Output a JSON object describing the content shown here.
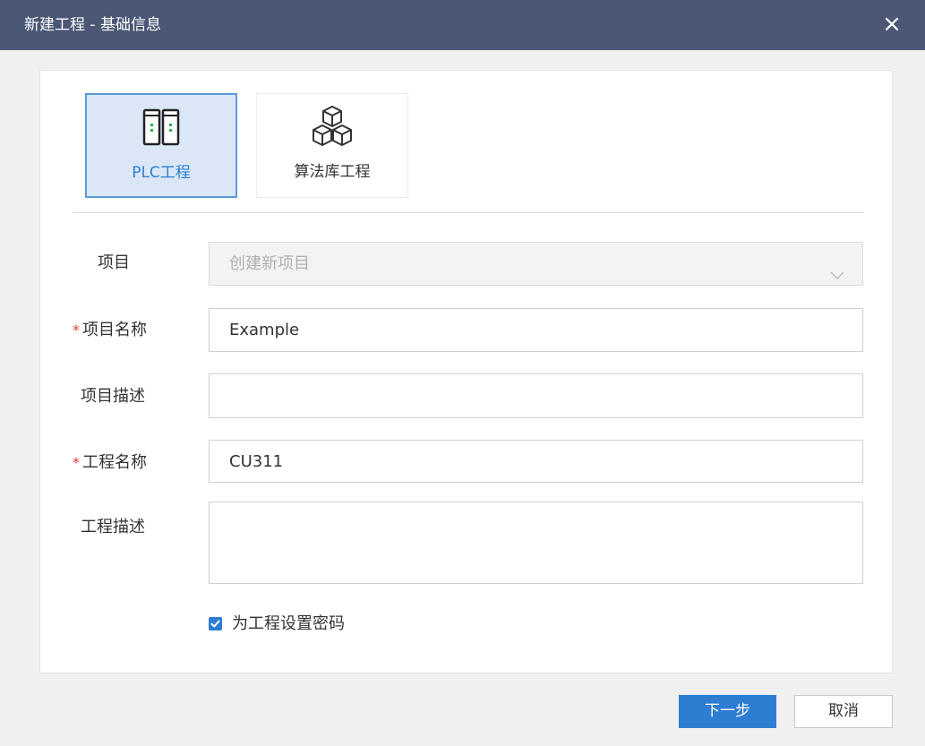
{
  "dialog": {
    "title": "新建工程 - 基础信息",
    "close_label": "×"
  },
  "project_types": [
    {
      "label": "PLC工程",
      "icon": "plc-device-icon",
      "selected": true
    },
    {
      "label": "算法库工程",
      "icon": "cubes-icon",
      "selected": false
    }
  ],
  "form": {
    "project": {
      "label": "项目",
      "value": "创建新项目",
      "disabled": true
    },
    "project_name": {
      "label": "项目名称",
      "value": "Example",
      "required": true
    },
    "project_desc": {
      "label": "项目描述",
      "value": ""
    },
    "engineering_name": {
      "label": "工程名称",
      "value": "CU311",
      "required": true
    },
    "engineering_desc": {
      "label": "工程描述",
      "value": ""
    },
    "set_password": {
      "label": "为工程设置密码",
      "checked": true
    },
    "required_mark": "*"
  },
  "buttons": {
    "next": "下一步",
    "cancel": "取消"
  },
  "colors": {
    "titlebar": "#4a5875",
    "accent": "#2d7dd2",
    "required": "#e53935",
    "selected_tile_bg": "#dbe7f6"
  }
}
